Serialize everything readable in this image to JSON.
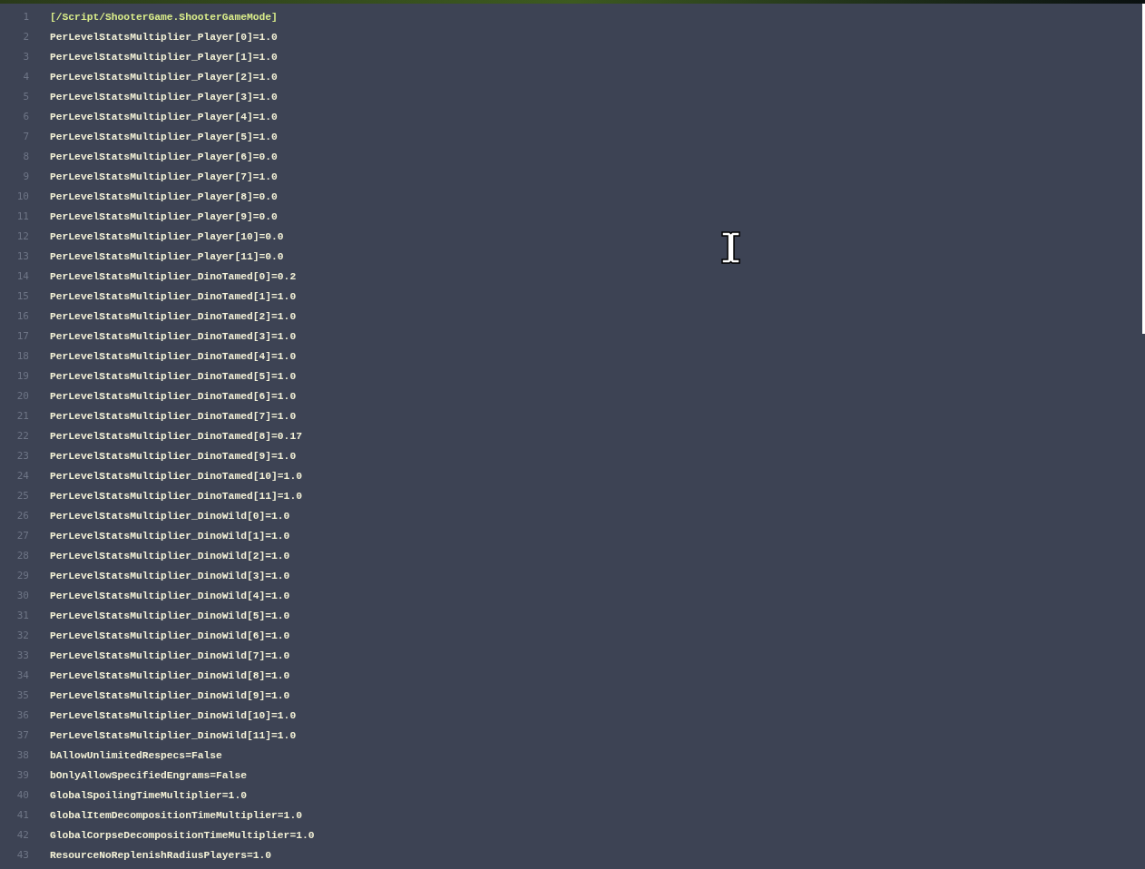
{
  "editor": {
    "lines": [
      {
        "number": "1",
        "kind": "section",
        "text": "[/Script/ShooterGame.ShooterGameMode]"
      },
      {
        "number": "2",
        "kind": "setting",
        "text": "PerLevelStatsMultiplier_Player[0]=1.0"
      },
      {
        "number": "3",
        "kind": "setting",
        "text": "PerLevelStatsMultiplier_Player[1]=1.0"
      },
      {
        "number": "4",
        "kind": "setting",
        "text": "PerLevelStatsMultiplier_Player[2]=1.0"
      },
      {
        "number": "5",
        "kind": "setting",
        "text": "PerLevelStatsMultiplier_Player[3]=1.0"
      },
      {
        "number": "6",
        "kind": "setting",
        "text": "PerLevelStatsMultiplier_Player[4]=1.0"
      },
      {
        "number": "7",
        "kind": "setting",
        "text": "PerLevelStatsMultiplier_Player[5]=1.0"
      },
      {
        "number": "8",
        "kind": "setting",
        "text": "PerLevelStatsMultiplier_Player[6]=0.0"
      },
      {
        "number": "9",
        "kind": "setting",
        "text": "PerLevelStatsMultiplier_Player[7]=1.0"
      },
      {
        "number": "10",
        "kind": "setting",
        "text": "PerLevelStatsMultiplier_Player[8]=0.0"
      },
      {
        "number": "11",
        "kind": "setting",
        "text": "PerLevelStatsMultiplier_Player[9]=0.0"
      },
      {
        "number": "12",
        "kind": "setting",
        "text": "PerLevelStatsMultiplier_Player[10]=0.0"
      },
      {
        "number": "13",
        "kind": "setting",
        "text": "PerLevelStatsMultiplier_Player[11]=0.0"
      },
      {
        "number": "14",
        "kind": "setting",
        "text": "PerLevelStatsMultiplier_DinoTamed[0]=0.2"
      },
      {
        "number": "15",
        "kind": "setting",
        "text": "PerLevelStatsMultiplier_DinoTamed[1]=1.0"
      },
      {
        "number": "16",
        "kind": "setting",
        "text": "PerLevelStatsMultiplier_DinoTamed[2]=1.0"
      },
      {
        "number": "17",
        "kind": "setting",
        "text": "PerLevelStatsMultiplier_DinoTamed[3]=1.0"
      },
      {
        "number": "18",
        "kind": "setting",
        "text": "PerLevelStatsMultiplier_DinoTamed[4]=1.0"
      },
      {
        "number": "19",
        "kind": "setting",
        "text": "PerLevelStatsMultiplier_DinoTamed[5]=1.0"
      },
      {
        "number": "20",
        "kind": "setting",
        "text": "PerLevelStatsMultiplier_DinoTamed[6]=1.0"
      },
      {
        "number": "21",
        "kind": "setting",
        "text": "PerLevelStatsMultiplier_DinoTamed[7]=1.0"
      },
      {
        "number": "22",
        "kind": "setting",
        "text": "PerLevelStatsMultiplier_DinoTamed[8]=0.17"
      },
      {
        "number": "23",
        "kind": "setting",
        "text": "PerLevelStatsMultiplier_DinoTamed[9]=1.0"
      },
      {
        "number": "24",
        "kind": "setting",
        "text": "PerLevelStatsMultiplier_DinoTamed[10]=1.0"
      },
      {
        "number": "25",
        "kind": "setting",
        "text": "PerLevelStatsMultiplier_DinoTamed[11]=1.0"
      },
      {
        "number": "26",
        "kind": "setting",
        "text": "PerLevelStatsMultiplier_DinoWild[0]=1.0"
      },
      {
        "number": "27",
        "kind": "setting",
        "text": "PerLevelStatsMultiplier_DinoWild[1]=1.0"
      },
      {
        "number": "28",
        "kind": "setting",
        "text": "PerLevelStatsMultiplier_DinoWild[2]=1.0"
      },
      {
        "number": "29",
        "kind": "setting",
        "text": "PerLevelStatsMultiplier_DinoWild[3]=1.0"
      },
      {
        "number": "30",
        "kind": "setting",
        "text": "PerLevelStatsMultiplier_DinoWild[4]=1.0"
      },
      {
        "number": "31",
        "kind": "setting",
        "text": "PerLevelStatsMultiplier_DinoWild[5]=1.0"
      },
      {
        "number": "32",
        "kind": "setting",
        "text": "PerLevelStatsMultiplier_DinoWild[6]=1.0"
      },
      {
        "number": "33",
        "kind": "setting",
        "text": "PerLevelStatsMultiplier_DinoWild[7]=1.0"
      },
      {
        "number": "34",
        "kind": "setting",
        "text": "PerLevelStatsMultiplier_DinoWild[8]=1.0"
      },
      {
        "number": "35",
        "kind": "setting",
        "text": "PerLevelStatsMultiplier_DinoWild[9]=1.0"
      },
      {
        "number": "36",
        "kind": "setting",
        "text": "PerLevelStatsMultiplier_DinoWild[10]=1.0"
      },
      {
        "number": "37",
        "kind": "setting",
        "text": "PerLevelStatsMultiplier_DinoWild[11]=1.0"
      },
      {
        "number": "38",
        "kind": "setting",
        "text": "bAllowUnlimitedRespecs=False"
      },
      {
        "number": "39",
        "kind": "setting",
        "text": "bOnlyAllowSpecifiedEngrams=False"
      },
      {
        "number": "40",
        "kind": "setting",
        "text": "GlobalSpoilingTimeMultiplier=1.0"
      },
      {
        "number": "41",
        "kind": "setting",
        "text": "GlobalItemDecompositionTimeMultiplier=1.0"
      },
      {
        "number": "42",
        "kind": "setting",
        "text": "GlobalCorpseDecompositionTimeMultiplier=1.0"
      },
      {
        "number": "43",
        "kind": "setting",
        "text": "ResourceNoReplenishRadiusPlayers=1.0"
      }
    ]
  }
}
